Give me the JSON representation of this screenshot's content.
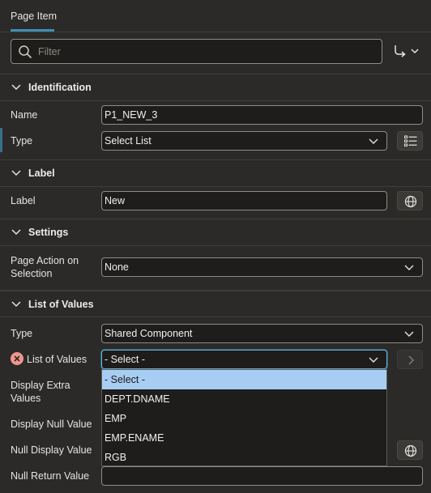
{
  "tab": {
    "label": "Page Item"
  },
  "filter": {
    "placeholder": "Filter"
  },
  "sections": {
    "identification": {
      "title": "Identification"
    },
    "label": {
      "title": "Label"
    },
    "settings": {
      "title": "Settings"
    },
    "lov": {
      "title": "List of Values"
    }
  },
  "identification": {
    "name_label": "Name",
    "name_value": "P1_NEW_3",
    "type_label": "Type",
    "type_value": "Select List"
  },
  "label_section": {
    "label_label": "Label",
    "label_value": "New"
  },
  "settings": {
    "page_action_label": "Page Action on Selection",
    "page_action_value": "None"
  },
  "lov": {
    "type_label": "Type",
    "type_value": "Shared Component",
    "list_label": "List of Values",
    "list_value": "- Select -",
    "display_extra_label": "Display Extra Values",
    "display_null_label": "Display Null Value",
    "null_display_label": "Null Display Value",
    "null_return_label": "Null Return Value",
    "options": [
      "- Select -",
      "DEPT.DNAME",
      "EMP",
      "EMP.ENAME",
      "RGB"
    ],
    "selected_option": "- Select -"
  },
  "icons": {
    "filter": "search-icon",
    "goto": "goto-arrow-icon",
    "list": "list-icon",
    "globe": "globe-icon",
    "chevron": "chevron-down-icon",
    "error": "error-icon",
    "next": "chevron-right-icon"
  },
  "colors": {
    "accent": "#3f8fb3",
    "error": "#f0968f",
    "selected_option_bg": "#a8cdf2",
    "background": "#2b2a28",
    "field_bg": "#1e1d1b"
  }
}
